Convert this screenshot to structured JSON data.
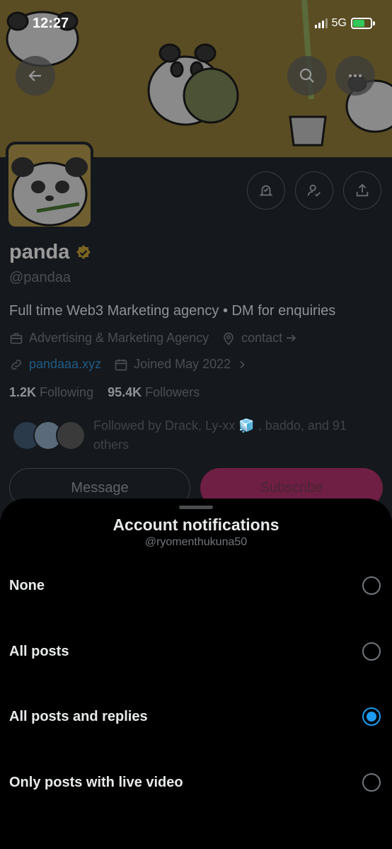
{
  "status_bar": {
    "time": "12:27",
    "network": "5G"
  },
  "profile": {
    "name": "panda",
    "handle": "@pandaa",
    "bio": "Full time Web3 Marketing agency • DM for enquiries",
    "category": "Advertising & Marketing Agency",
    "location": "contact ➔",
    "website": "pandaaa.xyz",
    "joined": "Joined May 2022",
    "following_count": "1.2K",
    "following_label": "Following",
    "followers_count": "95.4K",
    "followers_label": "Followers",
    "followed_by": "Followed by Drack, Ly-xx 🧊 , baddo, and 91 others",
    "message_label": "Message",
    "subscribe_label": "Subscribe"
  },
  "sheet": {
    "title": "Account notifications",
    "subtitle": "@ryomenthukuna50",
    "options": [
      {
        "label": "None",
        "selected": false
      },
      {
        "label": "All posts",
        "selected": false
      },
      {
        "label": "All posts and replies",
        "selected": true
      },
      {
        "label": "Only posts with live video",
        "selected": false
      }
    ]
  },
  "colors": {
    "accent": "#1d9bf0",
    "verified": "#c9a227",
    "subscribe": "#f91880"
  }
}
